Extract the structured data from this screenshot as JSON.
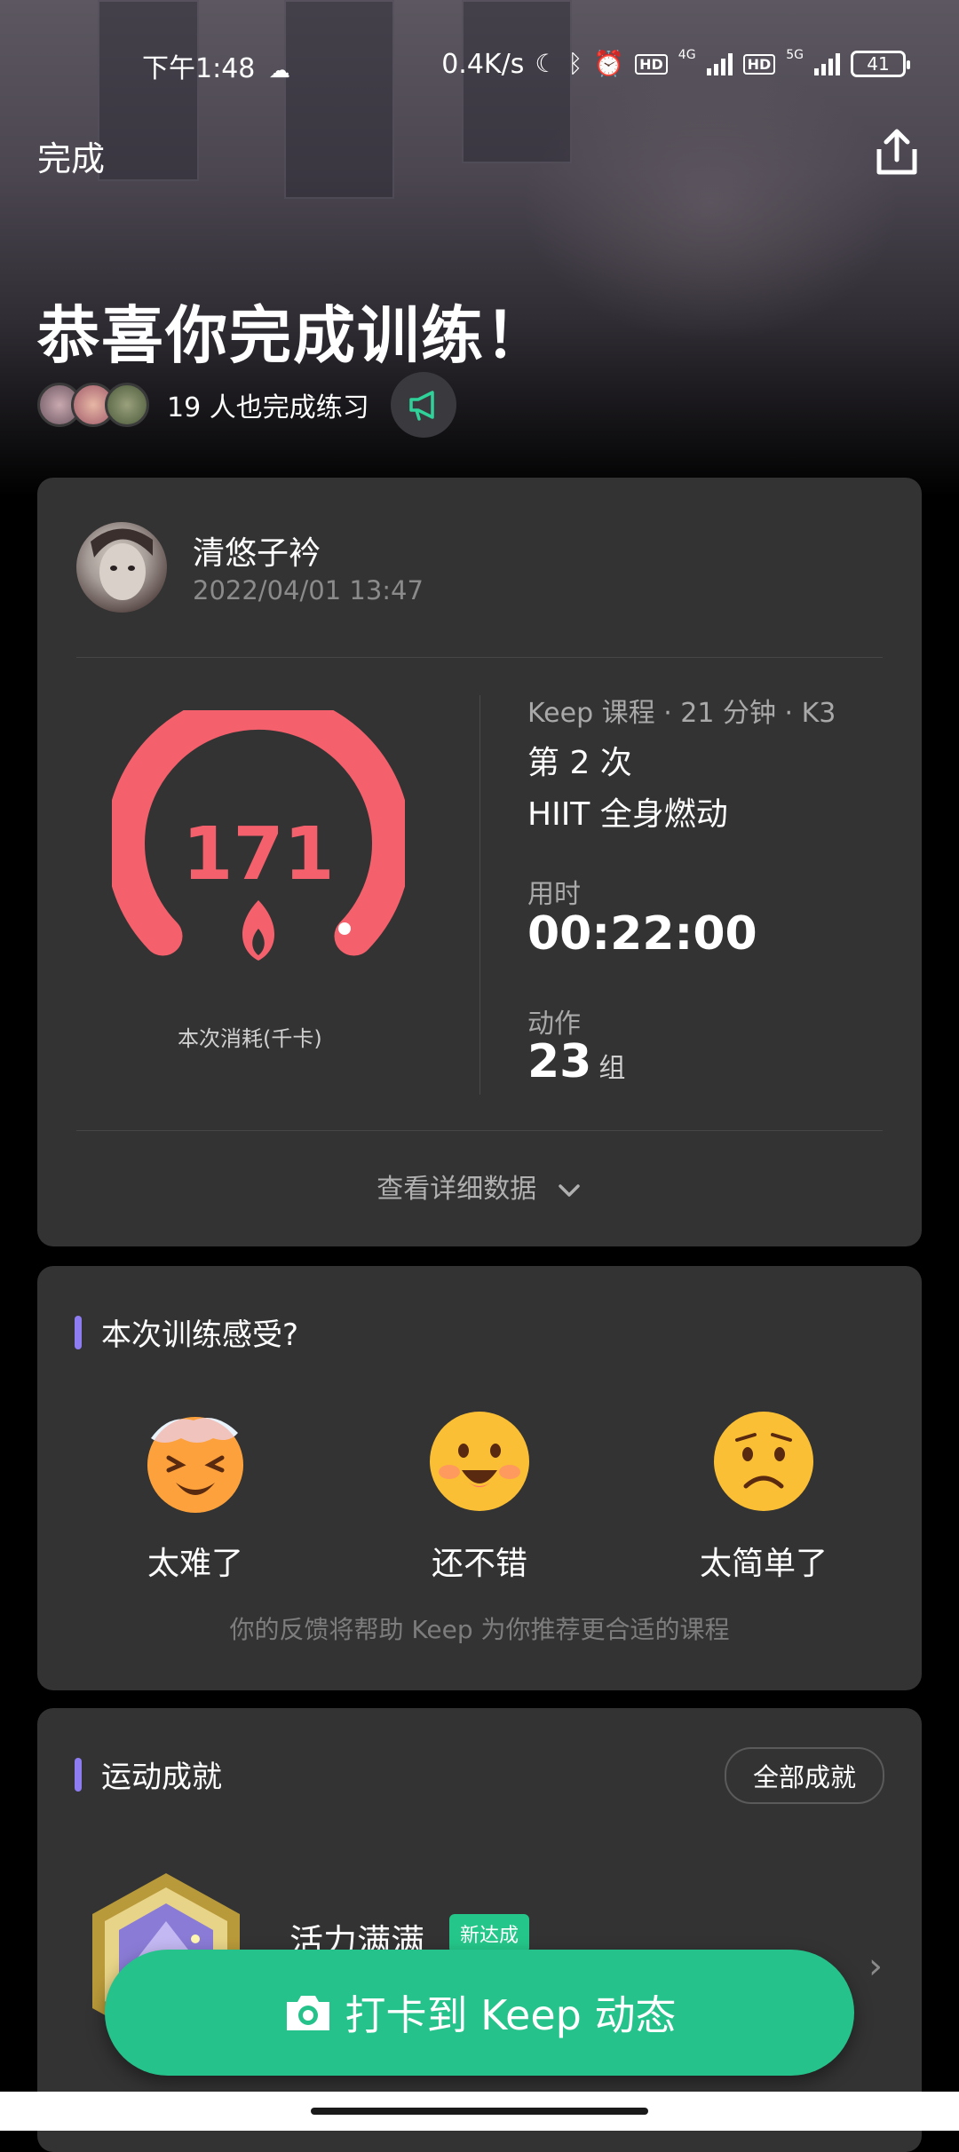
{
  "status_bar": {
    "time": "下午1:48",
    "net_speed": "0.4K/s",
    "net_4g": "4G",
    "net_5g": "5G",
    "hd": "HD",
    "battery": "41"
  },
  "header": {
    "done_label": "完成",
    "title": "恭喜你完成训练！",
    "others_text": "19 人也完成练习"
  },
  "summary_card": {
    "user_name": "清悠子衿",
    "datetime": "2022/04/01 13:47",
    "calories": "171",
    "calories_label": "本次消耗(千卡)",
    "course_meta": "Keep 课程  ·  21 分钟  ·  K3",
    "session_count": "第 2 次",
    "course_name": "HIIT 全身燃动",
    "duration_label": "用时",
    "duration_value": "00:22:00",
    "actions_label": "动作",
    "actions_value": "23",
    "actions_unit": "组",
    "detail_link": "查看详细数据"
  },
  "feedback_card": {
    "title": "本次训练感受?",
    "options": [
      {
        "label": "太难了",
        "icon": "hot-face-icon"
      },
      {
        "label": "还不错",
        "icon": "smile-face-icon"
      },
      {
        "label": "太简单了",
        "icon": "frown-face-icon"
      }
    ],
    "hint": "你的反馈将帮助 Keep 为你推荐更合适的课程"
  },
  "achievement_card": {
    "title": "运动成就",
    "all_button": "全部成就",
    "badge_name": "活力满满",
    "new_tag": "新达成"
  },
  "checkin_button": {
    "label": "打卡到 Keep 动态"
  },
  "colors": {
    "accent_green": "#26c28b",
    "gauge_red": "#f4606b",
    "section_bar_purple": "#8d7cf2",
    "card_bg": "#333333"
  }
}
